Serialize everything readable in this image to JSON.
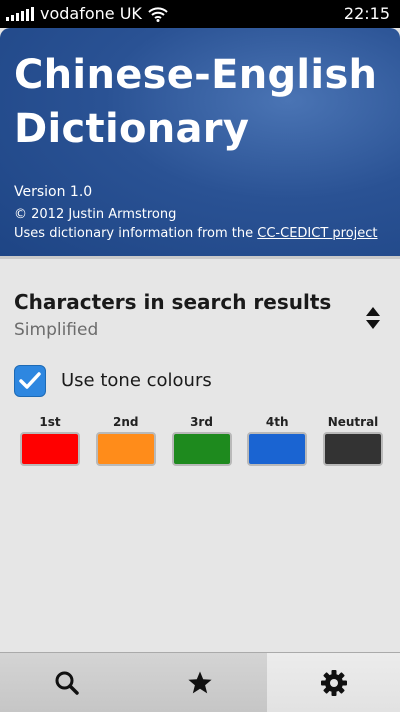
{
  "status_bar": {
    "carrier": "vodafone UK",
    "time": "22:15",
    "signal_icon": "signal-bars-icon",
    "wifi_icon": "wifi-icon"
  },
  "header": {
    "title": "Chinese-English Dictionary",
    "version": "Version 1.0",
    "copyright": "© 2012 Justin Armstrong",
    "source_prefix": "Uses dictionary information from the ",
    "source_link": "CC-CEDICT project"
  },
  "characters_setting": {
    "title": "Characters in search results",
    "value": "Simplified",
    "icon": "up-down-arrows-icon"
  },
  "tone_colours": {
    "checkbox_checked": true,
    "label": "Use tone colours",
    "tones": [
      {
        "label": "1st",
        "color": "#ff0000"
      },
      {
        "label": "2nd",
        "color": "#ff8c1a"
      },
      {
        "label": "3rd",
        "color": "#1e8a1e"
      },
      {
        "label": "4th",
        "color": "#1a64d2"
      },
      {
        "label": "Neutral",
        "color": "#333333"
      }
    ]
  },
  "toolbar": {
    "buttons": [
      {
        "icon": "search-icon",
        "active": false
      },
      {
        "icon": "star-icon",
        "active": false
      },
      {
        "icon": "gear-icon",
        "active": true
      }
    ]
  }
}
